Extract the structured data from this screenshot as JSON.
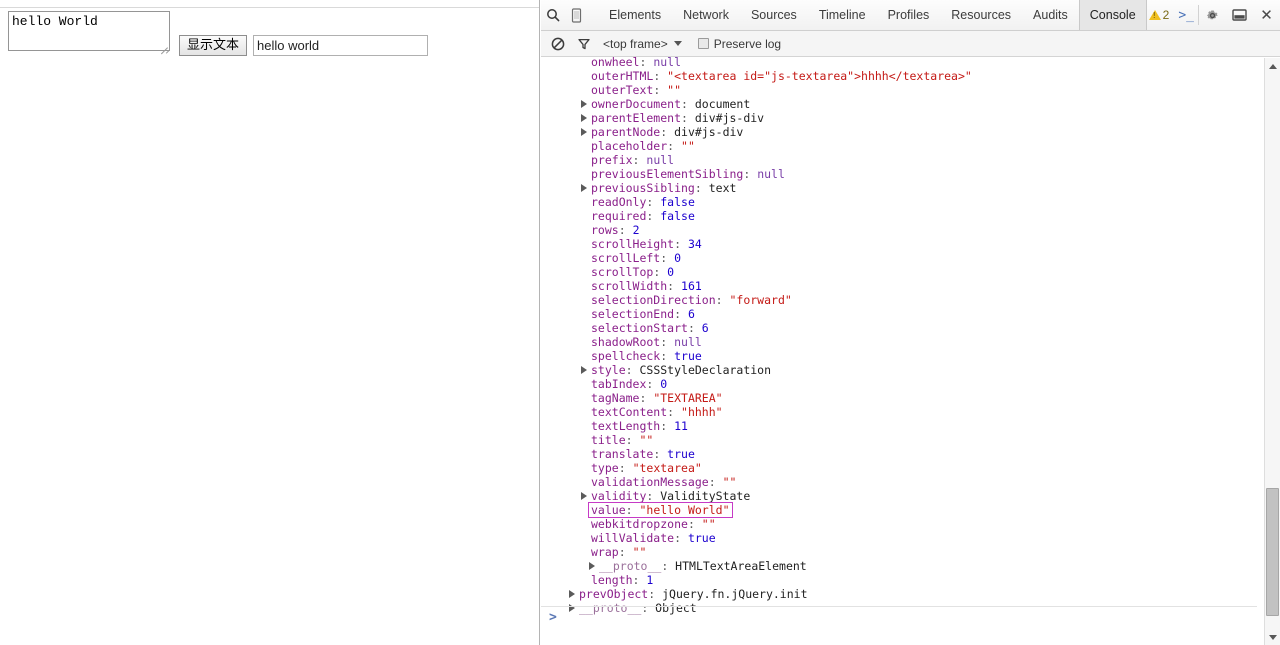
{
  "page": {
    "textarea": {
      "value": "hello World",
      "placeholder": ""
    },
    "button_label": "显示文本",
    "input": {
      "value": "hello world",
      "placeholder": ""
    }
  },
  "devtools": {
    "toolbar": {
      "search_icon": "search-icon",
      "device_icon": "device-toggle-icon",
      "tabs": [
        {
          "label": "Elements",
          "active": false
        },
        {
          "label": "Network",
          "active": false
        },
        {
          "label": "Sources",
          "active": false
        },
        {
          "label": "Timeline",
          "active": false
        },
        {
          "label": "Profiles",
          "active": false
        },
        {
          "label": "Resources",
          "active": false
        },
        {
          "label": "Audits",
          "active": false
        },
        {
          "label": "Console",
          "active": true
        }
      ],
      "warning_count": "2",
      "console_drawer_icon": ">_",
      "settings_icon": "gear-icon",
      "dock_icon": "dock-panel-icon",
      "close_label": "✕"
    },
    "filterbar": {
      "clear_icon": "clear-console-icon",
      "filter_icon": "filter-funnel-icon",
      "frame": "<top frame>",
      "preserve_log_label": "Preserve log",
      "preserve_log_checked": false
    },
    "console": {
      "prompt": ">",
      "properties": [
        {
          "level": 1,
          "arrow": false,
          "key": "onwheel",
          "sep": ": ",
          "value": "null",
          "vtype": "null",
          "cut": true
        },
        {
          "level": 1,
          "arrow": false,
          "key": "onwheel",
          "sep": ": ",
          "value": "null",
          "vtype": "null"
        },
        {
          "level": 1,
          "arrow": false,
          "key": "outerHTML",
          "sep": ": ",
          "value": "\"<textarea id=\"js-textarea\">hhhh</textarea>\"",
          "vtype": "str"
        },
        {
          "level": 1,
          "arrow": false,
          "key": "outerText",
          "sep": ": ",
          "value": "\"\"",
          "vtype": "str"
        },
        {
          "level": 1,
          "arrow": true,
          "key": "ownerDocument",
          "sep": ": ",
          "value": "document",
          "vtype": "obj"
        },
        {
          "level": 1,
          "arrow": true,
          "key": "parentElement",
          "sep": ": ",
          "value": "div#js-div",
          "vtype": "obj"
        },
        {
          "level": 1,
          "arrow": true,
          "key": "parentNode",
          "sep": ": ",
          "value": "div#js-div",
          "vtype": "obj"
        },
        {
          "level": 1,
          "arrow": false,
          "key": "placeholder",
          "sep": ": ",
          "value": "\"\"",
          "vtype": "str"
        },
        {
          "level": 1,
          "arrow": false,
          "key": "prefix",
          "sep": ": ",
          "value": "null",
          "vtype": "null"
        },
        {
          "level": 1,
          "arrow": false,
          "key": "previousElementSibling",
          "sep": ": ",
          "value": "null",
          "vtype": "null"
        },
        {
          "level": 1,
          "arrow": true,
          "key": "previousSibling",
          "sep": ": ",
          "value": "text",
          "vtype": "obj"
        },
        {
          "level": 1,
          "arrow": false,
          "key": "readOnly",
          "sep": ": ",
          "value": "false",
          "vtype": "bool"
        },
        {
          "level": 1,
          "arrow": false,
          "key": "required",
          "sep": ": ",
          "value": "false",
          "vtype": "bool"
        },
        {
          "level": 1,
          "arrow": false,
          "key": "rows",
          "sep": ": ",
          "value": "2",
          "vtype": "num"
        },
        {
          "level": 1,
          "arrow": false,
          "key": "scrollHeight",
          "sep": ": ",
          "value": "34",
          "vtype": "num"
        },
        {
          "level": 1,
          "arrow": false,
          "key": "scrollLeft",
          "sep": ": ",
          "value": "0",
          "vtype": "num"
        },
        {
          "level": 1,
          "arrow": false,
          "key": "scrollTop",
          "sep": ": ",
          "value": "0",
          "vtype": "num"
        },
        {
          "level": 1,
          "arrow": false,
          "key": "scrollWidth",
          "sep": ": ",
          "value": "161",
          "vtype": "num"
        },
        {
          "level": 1,
          "arrow": false,
          "key": "selectionDirection",
          "sep": ": ",
          "value": "\"forward\"",
          "vtype": "str"
        },
        {
          "level": 1,
          "arrow": false,
          "key": "selectionEnd",
          "sep": ": ",
          "value": "6",
          "vtype": "num"
        },
        {
          "level": 1,
          "arrow": false,
          "key": "selectionStart",
          "sep": ": ",
          "value": "6",
          "vtype": "num"
        },
        {
          "level": 1,
          "arrow": false,
          "key": "shadowRoot",
          "sep": ": ",
          "value": "null",
          "vtype": "null"
        },
        {
          "level": 1,
          "arrow": false,
          "key": "spellcheck",
          "sep": ": ",
          "value": "true",
          "vtype": "bool"
        },
        {
          "level": 1,
          "arrow": true,
          "key": "style",
          "sep": ": ",
          "value": "CSSStyleDeclaration",
          "vtype": "obj"
        },
        {
          "level": 1,
          "arrow": false,
          "key": "tabIndex",
          "sep": ": ",
          "value": "0",
          "vtype": "num"
        },
        {
          "level": 1,
          "arrow": false,
          "key": "tagName",
          "sep": ": ",
          "value": "\"TEXTAREA\"",
          "vtype": "str"
        },
        {
          "level": 1,
          "arrow": false,
          "key": "textContent",
          "sep": ": ",
          "value": "\"hhhh\"",
          "vtype": "str"
        },
        {
          "level": 1,
          "arrow": false,
          "key": "textLength",
          "sep": ": ",
          "value": "11",
          "vtype": "num"
        },
        {
          "level": 1,
          "arrow": false,
          "key": "title",
          "sep": ": ",
          "value": "\"\"",
          "vtype": "str"
        },
        {
          "level": 1,
          "arrow": false,
          "key": "translate",
          "sep": ": ",
          "value": "true",
          "vtype": "bool"
        },
        {
          "level": 1,
          "arrow": false,
          "key": "type",
          "sep": ": ",
          "value": "\"textarea\"",
          "vtype": "str"
        },
        {
          "level": 1,
          "arrow": false,
          "key": "validationMessage",
          "sep": ": ",
          "value": "\"\"",
          "vtype": "str"
        },
        {
          "level": 1,
          "arrow": true,
          "key": "validity",
          "sep": ": ",
          "value": "ValidityState",
          "vtype": "obj"
        },
        {
          "level": 1,
          "arrow": false,
          "key": "value",
          "sep": ": ",
          "value": "\"hello World\"",
          "vtype": "str",
          "highlighted": true
        },
        {
          "level": 1,
          "arrow": false,
          "key": "webkitdropzone",
          "sep": ": ",
          "value": "\"\"",
          "vtype": "str"
        },
        {
          "level": 1,
          "arrow": false,
          "key": "willValidate",
          "sep": ": ",
          "value": "true",
          "vtype": "bool"
        },
        {
          "level": 1,
          "arrow": false,
          "key": "wrap",
          "sep": ": ",
          "value": "\"\"",
          "vtype": "str"
        },
        {
          "level": 2,
          "arrow": true,
          "key": "__proto__",
          "sep": ": ",
          "value": "HTMLTextAreaElement",
          "vtype": "obj",
          "dimkey": true
        },
        {
          "level": 1,
          "arrow": false,
          "key": "length",
          "sep": ": ",
          "value": "1",
          "vtype": "num"
        },
        {
          "level": 0,
          "arrow": true,
          "key": "prevObject",
          "sep": ": ",
          "value": "jQuery.fn.jQuery.init",
          "vtype": "obj"
        },
        {
          "level": 0,
          "arrow": true,
          "key": "__proto__",
          "sep": ": ",
          "value": "Object",
          "vtype": "obj",
          "dimkey": true
        }
      ]
    }
  }
}
